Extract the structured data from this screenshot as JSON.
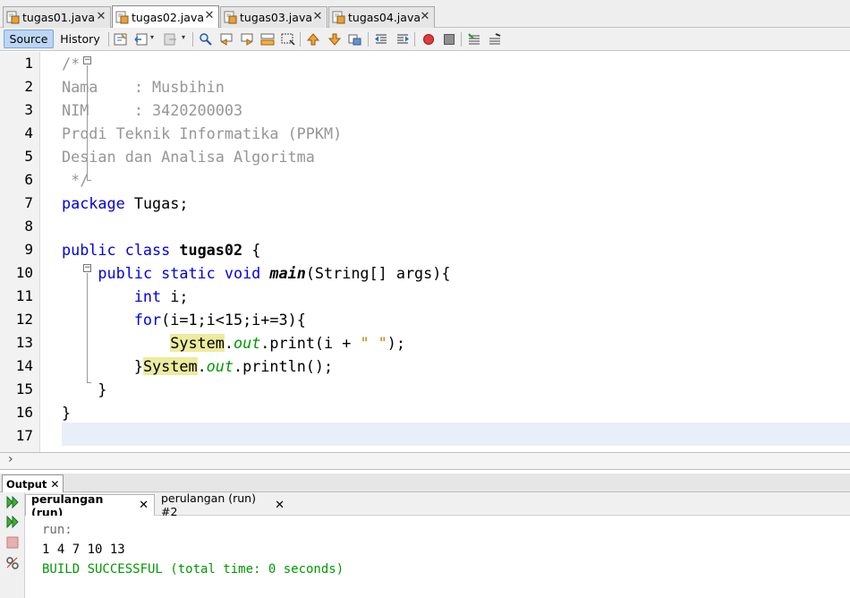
{
  "editor_tabs": [
    {
      "label": "tugas01.java",
      "active": false
    },
    {
      "label": "tugas02.java",
      "active": true
    },
    {
      "label": "tugas03.java",
      "active": false
    },
    {
      "label": "tugas04.java",
      "active": false
    }
  ],
  "toolbar": {
    "source_label": "Source",
    "history_label": "History"
  },
  "line_numbers": [
    "1",
    "2",
    "3",
    "4",
    "5",
    "6",
    "7",
    "8",
    "9",
    "10",
    "11",
    "12",
    "13",
    "14",
    "15",
    "16",
    "17"
  ],
  "code": {
    "l1": "/*",
    "l2": "Nama    : Musbihin",
    "l3": "NIM     : 3420200003",
    "l4": "Prodi Teknik Informatika (PPKM)",
    "l5": "Desian dan Analisa Algoritma",
    "l6": " */",
    "l7_kw": "package",
    "l7_rest": " Tugas;",
    "l9_kw": "public class",
    "l9_name": "tugas02",
    "l9_rest": " {",
    "l10_kw": "public static void",
    "l10_name": "main",
    "l10_rest": "(String[] args){",
    "l11_kw": "int",
    "l11_rest": " i;",
    "l12_kw": "for",
    "l12_rest": "(i=1;i<15;i+=3){",
    "l13_sys": "System",
    "l13_dot": ".",
    "l13_out": "out",
    "l13_mid": ".print(i + ",
    "l13_str": "\" \"",
    "l13_end": ");",
    "l14_brace": "}",
    "l14_sys": "System",
    "l14_dot": ".",
    "l14_out": "out",
    "l14_end": ".println();",
    "l15": "}",
    "l16": "}"
  },
  "output": {
    "panel_title": "Output",
    "tabs": [
      {
        "label": "perulangan (run)",
        "active": true
      },
      {
        "label": "perulangan (run) #2",
        "active": false
      }
    ],
    "lines": [
      "run:",
      "1 4 7 10 13",
      "BUILD SUCCESSFUL (total time: 0 seconds)"
    ]
  },
  "colors": {
    "keyword": "#0000e6",
    "comment": "#969696",
    "success": "#009900",
    "highlight": "#eceb9f",
    "string": "#ce7b00"
  }
}
